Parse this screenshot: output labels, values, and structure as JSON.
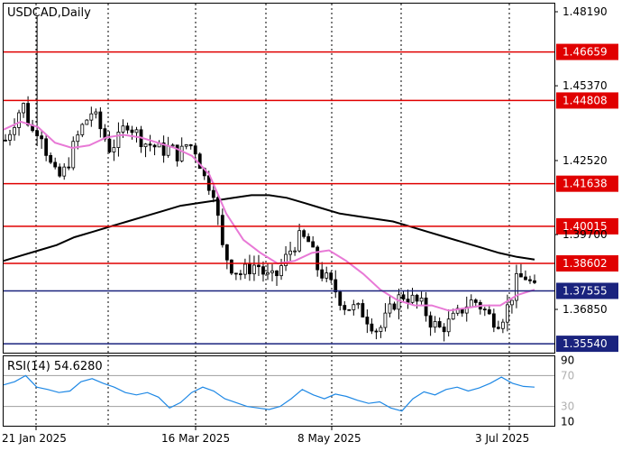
{
  "chart_data": {
    "type": "candlestick",
    "symbol": "USDCAD,Daily",
    "y_ticks": [
      "1.48190",
      "1.45370",
      "1.42520",
      "1.39700",
      "1.36850"
    ],
    "ylim": [
      1.352,
      1.485
    ],
    "x_ticks": [
      "21 Jan 2025",
      "16 Mar 2025",
      "8 May 2025",
      "3 Jul 2025"
    ],
    "levels": [
      {
        "label": "1.46659",
        "value": 1.46659,
        "color": "#e00000"
      },
      {
        "label": "1.44808",
        "value": 1.44808,
        "color": "#e00000"
      },
      {
        "label": "1.41638",
        "value": 1.41638,
        "color": "#e00000"
      },
      {
        "label": "1.40015",
        "value": 1.40015,
        "color": "#e00000"
      },
      {
        "label": "1.38602",
        "value": 1.38602,
        "color": "#e00000"
      },
      {
        "label": "1.37555",
        "value": 1.37555,
        "color": "#1a237e"
      },
      {
        "label": "1.35540",
        "value": 1.3554,
        "color": "#1a237e"
      }
    ],
    "ma_slow_color": "#000000",
    "ma_fast_color": "#e879d6",
    "close_path": [
      1.433,
      1.44,
      1.447,
      1.436,
      1.438,
      1.425,
      1.418,
      1.422,
      1.432,
      1.439,
      1.444,
      1.437,
      1.43,
      1.433,
      1.44,
      1.436,
      1.432,
      1.431,
      1.429,
      1.43,
      1.427,
      1.432,
      1.429,
      1.418,
      1.414,
      1.392,
      1.385,
      1.382,
      1.384,
      1.386,
      1.381,
      1.38,
      1.386,
      1.392,
      1.396,
      1.394,
      1.384,
      1.38,
      1.376,
      1.37,
      1.369,
      1.368,
      1.364,
      1.36,
      1.366,
      1.372,
      1.374,
      1.372,
      1.37,
      1.364,
      1.361,
      1.363,
      1.366,
      1.37,
      1.372,
      1.369,
      1.365,
      1.364,
      1.37,
      1.38,
      1.381,
      1.376
    ],
    "ma_slow": [
      1.387,
      1.389,
      1.391,
      1.393,
      1.396,
      1.398,
      1.4,
      1.402,
      1.404,
      1.406,
      1.408,
      1.409,
      1.41,
      1.411,
      1.412,
      1.412,
      1.411,
      1.409,
      1.407,
      1.405,
      1.404,
      1.403,
      1.402,
      1.4,
      1.398,
      1.396,
      1.394,
      1.392,
      1.39,
      1.3885,
      1.3875
    ],
    "ma_fast": [
      1.437,
      1.44,
      1.438,
      1.432,
      1.43,
      1.431,
      1.434,
      1.435,
      1.434,
      1.432,
      1.43,
      1.427,
      1.42,
      1.405,
      1.395,
      1.39,
      1.386,
      1.387,
      1.39,
      1.391,
      1.387,
      1.382,
      1.376,
      1.372,
      1.37,
      1.37,
      1.368,
      1.369,
      1.37,
      1.37,
      1.374,
      1.376
    ],
    "rsi": {
      "label": "RSI(14) 54.6280",
      "y_ticks": [
        "90",
        "70",
        "30",
        "10"
      ],
      "levels": [
        70,
        30
      ],
      "ylim": [
        5,
        95
      ],
      "color": "#1e88e5",
      "values": [
        58,
        62,
        70,
        55,
        52,
        48,
        50,
        62,
        66,
        60,
        55,
        48,
        45,
        48,
        42,
        28,
        35,
        48,
        55,
        50,
        40,
        35,
        30,
        28,
        26,
        30,
        40,
        52,
        45,
        40,
        46,
        43,
        38,
        34,
        36,
        28,
        24,
        40,
        49,
        45,
        52,
        55,
        50,
        54,
        60,
        68,
        60,
        56,
        55
      ]
    }
  }
}
